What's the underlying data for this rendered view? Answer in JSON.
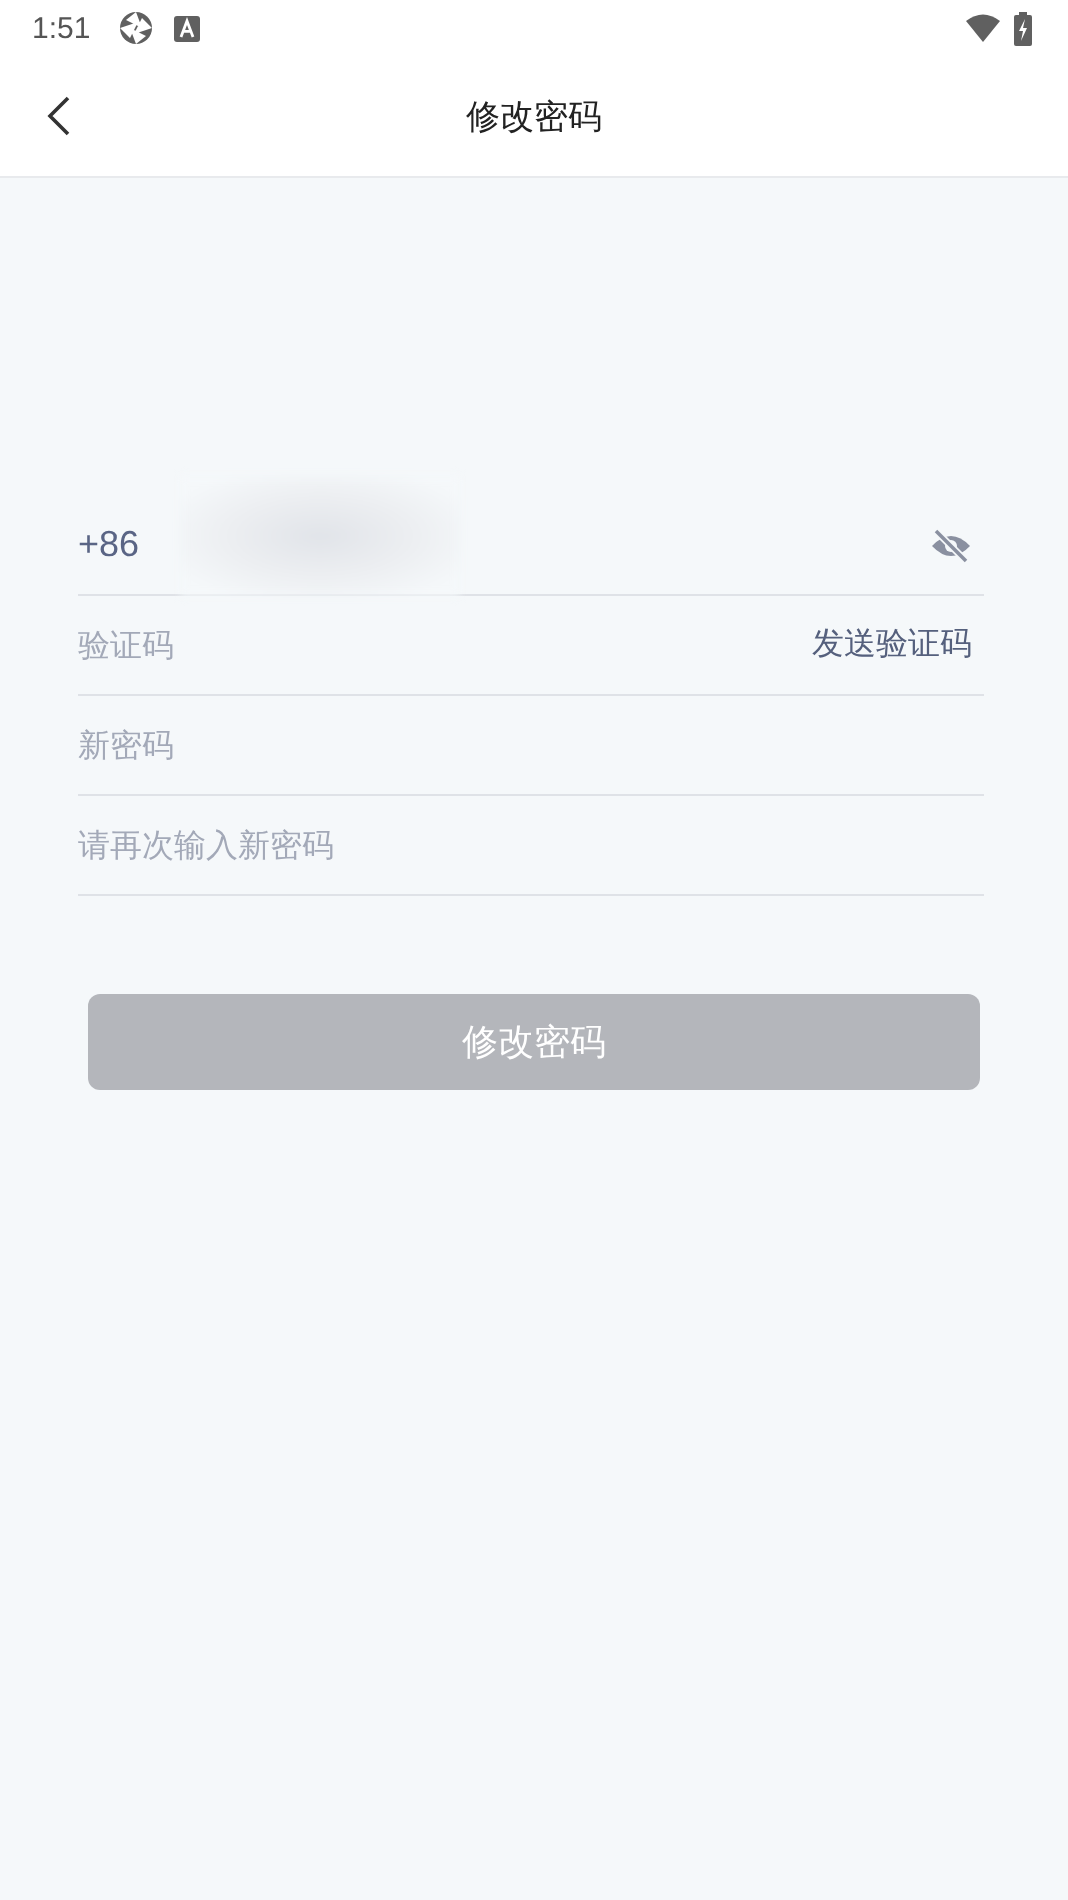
{
  "status_bar": {
    "time": "1:51"
  },
  "header": {
    "title": "修改密码"
  },
  "form": {
    "phone": {
      "prefix": "+86",
      "redacted": true,
      "number_visible": false
    },
    "fields": [
      {
        "kind": "code",
        "placeholder": "验证码",
        "action": "发送验证码"
      },
      {
        "kind": "password",
        "placeholder": "新密码"
      },
      {
        "kind": "password",
        "placeholder": "请再次输入新密码"
      }
    ]
  },
  "submit": {
    "label": "修改密码",
    "disabled": true
  }
}
